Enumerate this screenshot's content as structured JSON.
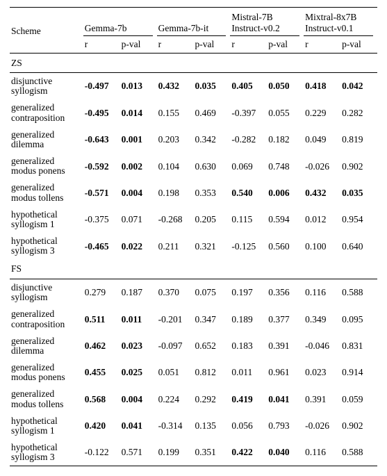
{
  "header": {
    "scheme_label": "Scheme",
    "models": [
      "Gemma-7b",
      "Gemma-7b-it",
      "Mistral-7B Instruct-v0.2",
      "Mixtral-8x7B Instruct-v0.1"
    ],
    "sub_r": "r",
    "sub_p": "p-val"
  },
  "sections": [
    {
      "label": "ZS",
      "rows": [
        {
          "label": "disjunctive syllogism",
          "cells": [
            {
              "v": "-0.497",
              "b": true
            },
            {
              "v": "0.013",
              "b": true
            },
            {
              "v": "0.432",
              "b": true
            },
            {
              "v": "0.035",
              "b": true
            },
            {
              "v": "0.405",
              "b": true
            },
            {
              "v": "0.050",
              "b": true
            },
            {
              "v": "0.418",
              "b": true
            },
            {
              "v": "0.042",
              "b": true
            }
          ]
        },
        {
          "label": "generalized contraposition",
          "cells": [
            {
              "v": "-0.495",
              "b": true
            },
            {
              "v": "0.014",
              "b": true
            },
            {
              "v": "0.155",
              "b": false
            },
            {
              "v": "0.469",
              "b": false
            },
            {
              "v": "-0.397",
              "b": false
            },
            {
              "v": "0.055",
              "b": false
            },
            {
              "v": "0.229",
              "b": false
            },
            {
              "v": "0.282",
              "b": false
            }
          ]
        },
        {
          "label": "generalized dilemma",
          "cells": [
            {
              "v": "-0.643",
              "b": true
            },
            {
              "v": "0.001",
              "b": true
            },
            {
              "v": "0.203",
              "b": false
            },
            {
              "v": "0.342",
              "b": false
            },
            {
              "v": "-0.282",
              "b": false
            },
            {
              "v": "0.182",
              "b": false
            },
            {
              "v": "0.049",
              "b": false
            },
            {
              "v": "0.819",
              "b": false
            }
          ]
        },
        {
          "label": "generalized modus ponens",
          "cells": [
            {
              "v": "-0.592",
              "b": true
            },
            {
              "v": "0.002",
              "b": true
            },
            {
              "v": "0.104",
              "b": false
            },
            {
              "v": "0.630",
              "b": false
            },
            {
              "v": "0.069",
              "b": false
            },
            {
              "v": "0.748",
              "b": false
            },
            {
              "v": "-0.026",
              "b": false
            },
            {
              "v": "0.902",
              "b": false
            }
          ]
        },
        {
          "label": "generalized modus tollens",
          "cells": [
            {
              "v": "-0.571",
              "b": true
            },
            {
              "v": "0.004",
              "b": true
            },
            {
              "v": "0.198",
              "b": false
            },
            {
              "v": "0.353",
              "b": false
            },
            {
              "v": "0.540",
              "b": true
            },
            {
              "v": "0.006",
              "b": true
            },
            {
              "v": "0.432",
              "b": true
            },
            {
              "v": "0.035",
              "b": true
            }
          ]
        },
        {
          "label": "hypothetical syllogism 1",
          "cells": [
            {
              "v": "-0.375",
              "b": false
            },
            {
              "v": "0.071",
              "b": false
            },
            {
              "v": "-0.268",
              "b": false
            },
            {
              "v": "0.205",
              "b": false
            },
            {
              "v": "0.115",
              "b": false
            },
            {
              "v": "0.594",
              "b": false
            },
            {
              "v": "0.012",
              "b": false
            },
            {
              "v": "0.954",
              "b": false
            }
          ]
        },
        {
          "label": "hypothetical syllogism 3",
          "cells": [
            {
              "v": "-0.465",
              "b": true
            },
            {
              "v": "0.022",
              "b": true
            },
            {
              "v": "0.211",
              "b": false
            },
            {
              "v": "0.321",
              "b": false
            },
            {
              "v": "-0.125",
              "b": false
            },
            {
              "v": "0.560",
              "b": false
            },
            {
              "v": "0.100",
              "b": false
            },
            {
              "v": "0.640",
              "b": false
            }
          ]
        }
      ]
    },
    {
      "label": "FS",
      "rows": [
        {
          "label": "disjunctive syllogism",
          "cells": [
            {
              "v": "0.279",
              "b": false
            },
            {
              "v": "0.187",
              "b": false
            },
            {
              "v": "0.370",
              "b": false
            },
            {
              "v": "0.075",
              "b": false
            },
            {
              "v": "0.197",
              "b": false
            },
            {
              "v": "0.356",
              "b": false
            },
            {
              "v": "0.116",
              "b": false
            },
            {
              "v": "0.588",
              "b": false
            }
          ]
        },
        {
          "label": "generalized contraposition",
          "cells": [
            {
              "v": "0.511",
              "b": true
            },
            {
              "v": "0.011",
              "b": true
            },
            {
              "v": "-0.201",
              "b": false
            },
            {
              "v": "0.347",
              "b": false
            },
            {
              "v": "0.189",
              "b": false
            },
            {
              "v": "0.377",
              "b": false
            },
            {
              "v": "0.349",
              "b": false
            },
            {
              "v": "0.095",
              "b": false
            }
          ]
        },
        {
          "label": "generalized dilemma",
          "cells": [
            {
              "v": "0.462",
              "b": true
            },
            {
              "v": "0.023",
              "b": true
            },
            {
              "v": "-0.097",
              "b": false
            },
            {
              "v": "0.652",
              "b": false
            },
            {
              "v": "0.183",
              "b": false
            },
            {
              "v": "0.391",
              "b": false
            },
            {
              "v": "-0.046",
              "b": false
            },
            {
              "v": "0.831",
              "b": false
            }
          ]
        },
        {
          "label": "generalized modus ponens",
          "cells": [
            {
              "v": "0.455",
              "b": true
            },
            {
              "v": "0.025",
              "b": true
            },
            {
              "v": "0.051",
              "b": false
            },
            {
              "v": "0.812",
              "b": false
            },
            {
              "v": "0.011",
              "b": false
            },
            {
              "v": "0.961",
              "b": false
            },
            {
              "v": "0.023",
              "b": false
            },
            {
              "v": "0.914",
              "b": false
            }
          ]
        },
        {
          "label": "generalized modus tollens",
          "cells": [
            {
              "v": "0.568",
              "b": true
            },
            {
              "v": "0.004",
              "b": true
            },
            {
              "v": "0.224",
              "b": false
            },
            {
              "v": "0.292",
              "b": false
            },
            {
              "v": "0.419",
              "b": true
            },
            {
              "v": "0.041",
              "b": true
            },
            {
              "v": "0.391",
              "b": false
            },
            {
              "v": "0.059",
              "b": false
            }
          ]
        },
        {
          "label": "hypothetical syllogism 1",
          "cells": [
            {
              "v": "0.420",
              "b": true
            },
            {
              "v": "0.041",
              "b": true
            },
            {
              "v": "-0.314",
              "b": false
            },
            {
              "v": "0.135",
              "b": false
            },
            {
              "v": "0.056",
              "b": false
            },
            {
              "v": "0.793",
              "b": false
            },
            {
              "v": "-0.026",
              "b": false
            },
            {
              "v": "0.902",
              "b": false
            }
          ]
        },
        {
          "label": "hypothetical syllogism 3",
          "cells": [
            {
              "v": "-0.122",
              "b": false
            },
            {
              "v": "0.571",
              "b": false
            },
            {
              "v": "0.199",
              "b": false
            },
            {
              "v": "0.351",
              "b": false
            },
            {
              "v": "0.422",
              "b": true
            },
            {
              "v": "0.040",
              "b": true
            },
            {
              "v": "0.116",
              "b": false
            },
            {
              "v": "0.588",
              "b": false
            }
          ]
        }
      ]
    }
  ],
  "chart_data": {
    "type": "table",
    "title": "",
    "columns": [
      "Scheme",
      "Gemma-7b r",
      "Gemma-7b p-val",
      "Gemma-7b-it r",
      "Gemma-7b-it p-val",
      "Mistral-7B Instruct-v0.2 r",
      "Mistral-7B Instruct-v0.2 p-val",
      "Mixtral-8x7B Instruct-v0.1 r",
      "Mixtral-8x7B Instruct-v0.1 p-val"
    ],
    "sections": {
      "ZS": [
        [
          "disjunctive syllogism",
          -0.497,
          0.013,
          0.432,
          0.035,
          0.405,
          0.05,
          0.418,
          0.042
        ],
        [
          "generalized contraposition",
          -0.495,
          0.014,
          0.155,
          0.469,
          -0.397,
          0.055,
          0.229,
          0.282
        ],
        [
          "generalized dilemma",
          -0.643,
          0.001,
          0.203,
          0.342,
          -0.282,
          0.182,
          0.049,
          0.819
        ],
        [
          "generalized modus ponens",
          -0.592,
          0.002,
          0.104,
          0.63,
          0.069,
          0.748,
          -0.026,
          0.902
        ],
        [
          "generalized modus tollens",
          -0.571,
          0.004,
          0.198,
          0.353,
          0.54,
          0.006,
          0.432,
          0.035
        ],
        [
          "hypothetical syllogism 1",
          -0.375,
          0.071,
          -0.268,
          0.205,
          0.115,
          0.594,
          0.012,
          0.954
        ],
        [
          "hypothetical syllogism 3",
          -0.465,
          0.022,
          0.211,
          0.321,
          -0.125,
          0.56,
          0.1,
          0.64
        ]
      ],
      "FS": [
        [
          "disjunctive syllogism",
          0.279,
          0.187,
          0.37,
          0.075,
          0.197,
          0.356,
          0.116,
          0.588
        ],
        [
          "generalized contraposition",
          0.511,
          0.011,
          -0.201,
          0.347,
          0.189,
          0.377,
          0.349,
          0.095
        ],
        [
          "generalized dilemma",
          0.462,
          0.023,
          -0.097,
          0.652,
          0.183,
          0.391,
          -0.046,
          0.831
        ],
        [
          "generalized modus ponens",
          0.455,
          0.025,
          0.051,
          0.812,
          0.011,
          0.961,
          0.023,
          0.914
        ],
        [
          "generalized modus tollens",
          0.568,
          0.004,
          0.224,
          0.292,
          0.419,
          0.041,
          0.391,
          0.059
        ],
        [
          "hypothetical syllogism 1",
          0.42,
          0.041,
          -0.314,
          0.135,
          0.056,
          0.793,
          -0.026,
          0.902
        ],
        [
          "hypothetical syllogism 3",
          -0.122,
          0.571,
          0.199,
          0.351,
          0.422,
          0.04,
          0.116,
          0.588
        ]
      ]
    }
  }
}
